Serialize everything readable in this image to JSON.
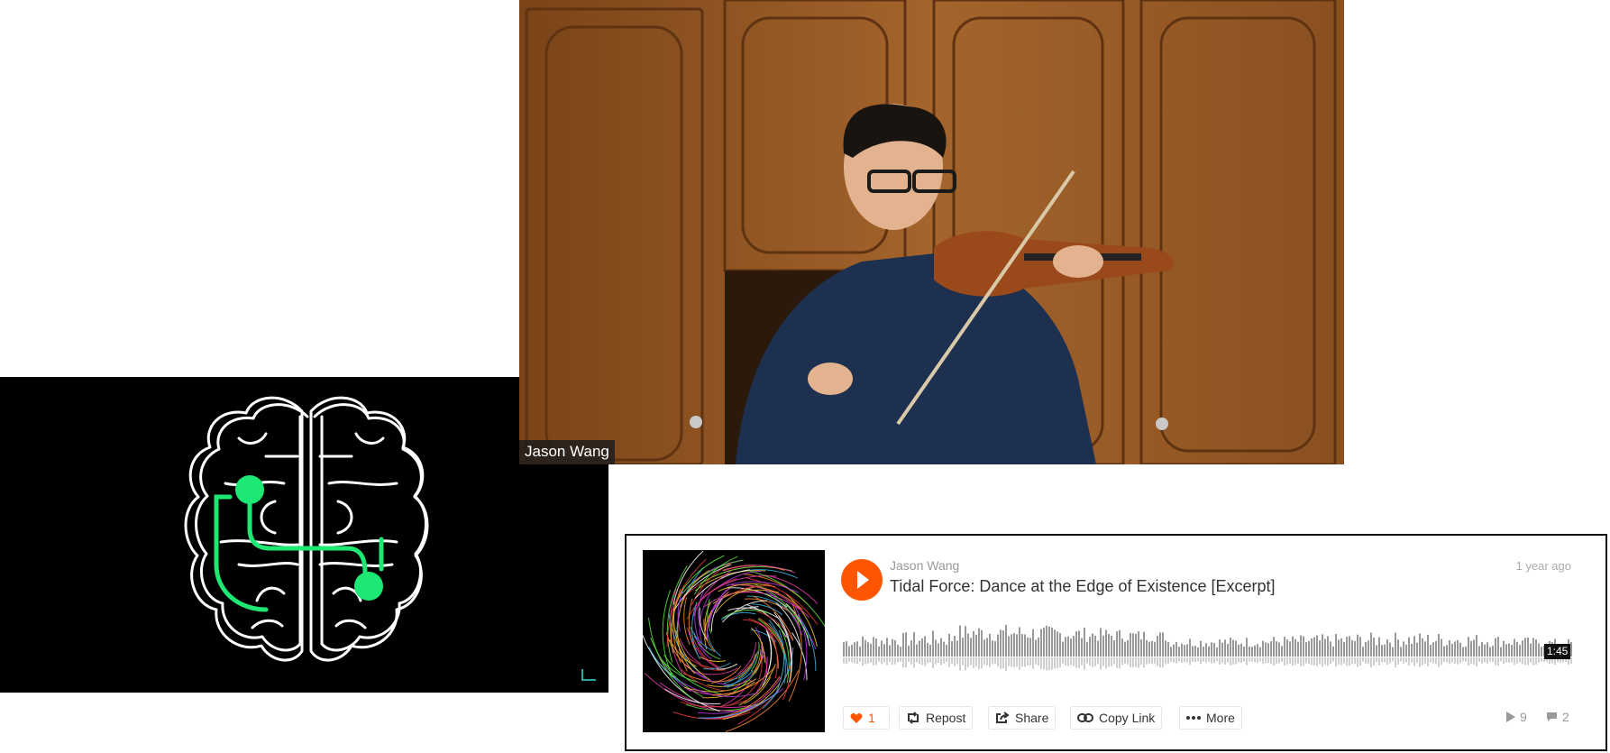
{
  "brain_logo": {
    "panel_color": "#000000",
    "stroke_color": "#ffffff",
    "accent_color": "#1ee874",
    "corner_icon": "corner-bracket-icon"
  },
  "video_tile": {
    "participant_name": "Jason Wang"
  },
  "soundcloud": {
    "artist": "Jason Wang",
    "title": "Tidal Force: Dance at the Edge of Existence [Excerpt]",
    "posted": "1 year ago",
    "duration": "1:45",
    "accent_color": "#ff5500",
    "buttons": {
      "like_count": "1",
      "repost": "Repost",
      "share": "Share",
      "copy_link": "Copy Link",
      "more": "More"
    },
    "stats": {
      "plays": "9",
      "comments": "2"
    },
    "icons": {
      "play": "play-icon",
      "like": "heart-icon",
      "repost": "repost-icon",
      "share": "share-icon",
      "copy_link": "link-icon",
      "more": "more-dots-icon",
      "plays": "play-count-icon",
      "comments": "comment-icon"
    }
  }
}
